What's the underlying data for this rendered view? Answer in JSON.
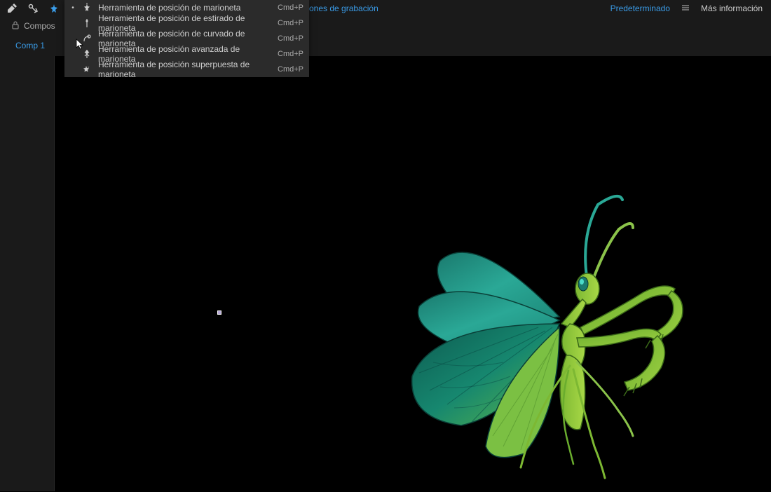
{
  "toolbar": {
    "recording_options": "ones de grabación",
    "workspace": "Predeterminado",
    "more_info": "Más información"
  },
  "panel": {
    "composition_label": "Compos"
  },
  "tabs": {
    "comp1": "Comp 1"
  },
  "puppet_menu": {
    "items": [
      {
        "label": "Herramienta de posición de marioneta",
        "shortcut": "Cmd+P",
        "selected": true
      },
      {
        "label": "Herramienta de posición de estirado de marioneta",
        "shortcut": "Cmd+P",
        "selected": false
      },
      {
        "label": "Herramienta de posición de curvado de marioneta",
        "shortcut": "Cmd+P",
        "selected": false
      },
      {
        "label": "Herramienta de posición avanzada de marioneta",
        "shortcut": "Cmd+P",
        "selected": false
      },
      {
        "label": "Herramienta de posición superpuesta de marioneta",
        "shortcut": "Cmd+P",
        "selected": false
      }
    ]
  }
}
